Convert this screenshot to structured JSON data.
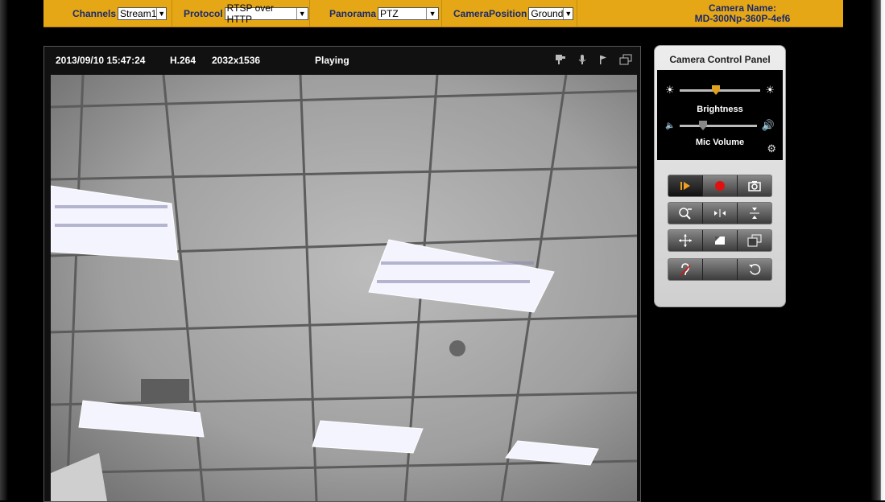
{
  "header": {
    "channels_label": "Channels",
    "channels_value": "Stream1",
    "protocol_label": "Protocol",
    "protocol_value": "RTSP over HTTP",
    "panorama_label": "Panorama",
    "panorama_value": "PTZ",
    "camera_position_label": "CameraPosition",
    "camera_position_value": "Ground",
    "camera_name_label": "Camera Name:",
    "camera_name_value": "MD-300Np-360P-4ef6"
  },
  "viewer": {
    "timestamp": "2013/09/10 15:47:24",
    "codec": "H.264",
    "resolution": "2032x1536",
    "status": "Playing"
  },
  "control_panel": {
    "title": "Camera Control Panel",
    "brightness_label": "Brightness",
    "brightness_level": 0.45,
    "mic_volume_label": "Mic Volume",
    "mic_volume_level": 0.3
  },
  "colors": {
    "topbar": "#e6a716",
    "label_text": "#1a2a6c",
    "knob": "#e0a020",
    "record": "#e01010"
  }
}
